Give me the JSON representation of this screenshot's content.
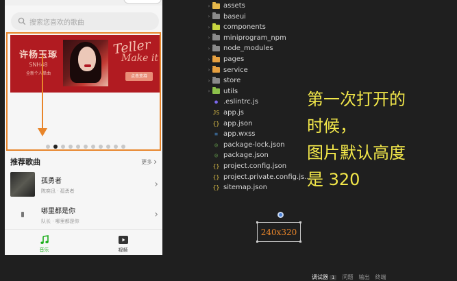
{
  "phone": {
    "search_placeholder": "搜索您喜欢的歌曲",
    "banner": {
      "title": "许杨玉琢",
      "subtitle": "SNH48",
      "tagline": "全新个人单曲",
      "script": "Teller",
      "script2": "Make it",
      "button": "点击支持"
    },
    "dots_count": 11,
    "active_dot": 1,
    "section": {
      "title": "推荐歌曲",
      "more": "更多"
    },
    "songs": [
      {
        "name": "孤勇者",
        "artist": "陈奕迅 · 孤勇者"
      },
      {
        "name": "哪里都是你",
        "artist": "队长 · 哪里都是你"
      }
    ],
    "tabs": [
      {
        "label": "音乐",
        "icon": "music-note-icon",
        "active": true
      },
      {
        "label": "视频",
        "icon": "video-play-icon",
        "active": false
      }
    ],
    "accent_color": "#1aad19",
    "annotation_color": "#e8852a"
  },
  "file_tree": [
    {
      "name": "assets",
      "type": "folder",
      "color": "#e6b84a"
    },
    {
      "name": "baseui",
      "type": "folder",
      "color": "#8a8a8a"
    },
    {
      "name": "components",
      "type": "folder",
      "color": "#c8d640"
    },
    {
      "name": "miniprogram_npm",
      "type": "folder",
      "color": "#8a8a8a"
    },
    {
      "name": "node_modules",
      "type": "folder",
      "color": "#8a8a8a"
    },
    {
      "name": "pages",
      "type": "folder",
      "color": "#e6a040"
    },
    {
      "name": "service",
      "type": "folder",
      "color": "#e6a040"
    },
    {
      "name": "store",
      "type": "folder",
      "color": "#8a8a8a"
    },
    {
      "name": "utils",
      "type": "folder",
      "color": "#8cc04a"
    },
    {
      "name": ".eslintrc.js",
      "type": "file",
      "icon": "eslint-icon",
      "color": "#7b68ee"
    },
    {
      "name": "app.js",
      "type": "file",
      "icon": "js-icon",
      "color": "#e8c84a"
    },
    {
      "name": "app.json",
      "type": "file",
      "icon": "json-icon",
      "color": "#e8c84a"
    },
    {
      "name": "app.wxss",
      "type": "file",
      "icon": "css-icon",
      "color": "#4a90d6"
    },
    {
      "name": "package-lock.json",
      "type": "file",
      "icon": "npm-icon",
      "color": "#6aa84f"
    },
    {
      "name": "package.json",
      "type": "file",
      "icon": "npm-icon",
      "color": "#6aa84f"
    },
    {
      "name": "project.config.json",
      "type": "file",
      "icon": "json-icon",
      "color": "#e8c84a"
    },
    {
      "name": "project.private.config.js...",
      "type": "file",
      "icon": "json-icon",
      "color": "#e8c84a"
    },
    {
      "name": "sitemap.json",
      "type": "file",
      "icon": "json-icon",
      "color": "#e8c84a"
    }
  ],
  "annotation": {
    "lines": [
      "第一次打开的",
      "时候，",
      "图片默认高度",
      "是 320"
    ]
  },
  "dimension_label": "240x320",
  "panel_tabs": [
    {
      "label": "调试器",
      "badge": "1",
      "active": true
    },
    {
      "label": "问题"
    },
    {
      "label": "输出"
    },
    {
      "label": "终端"
    }
  ]
}
